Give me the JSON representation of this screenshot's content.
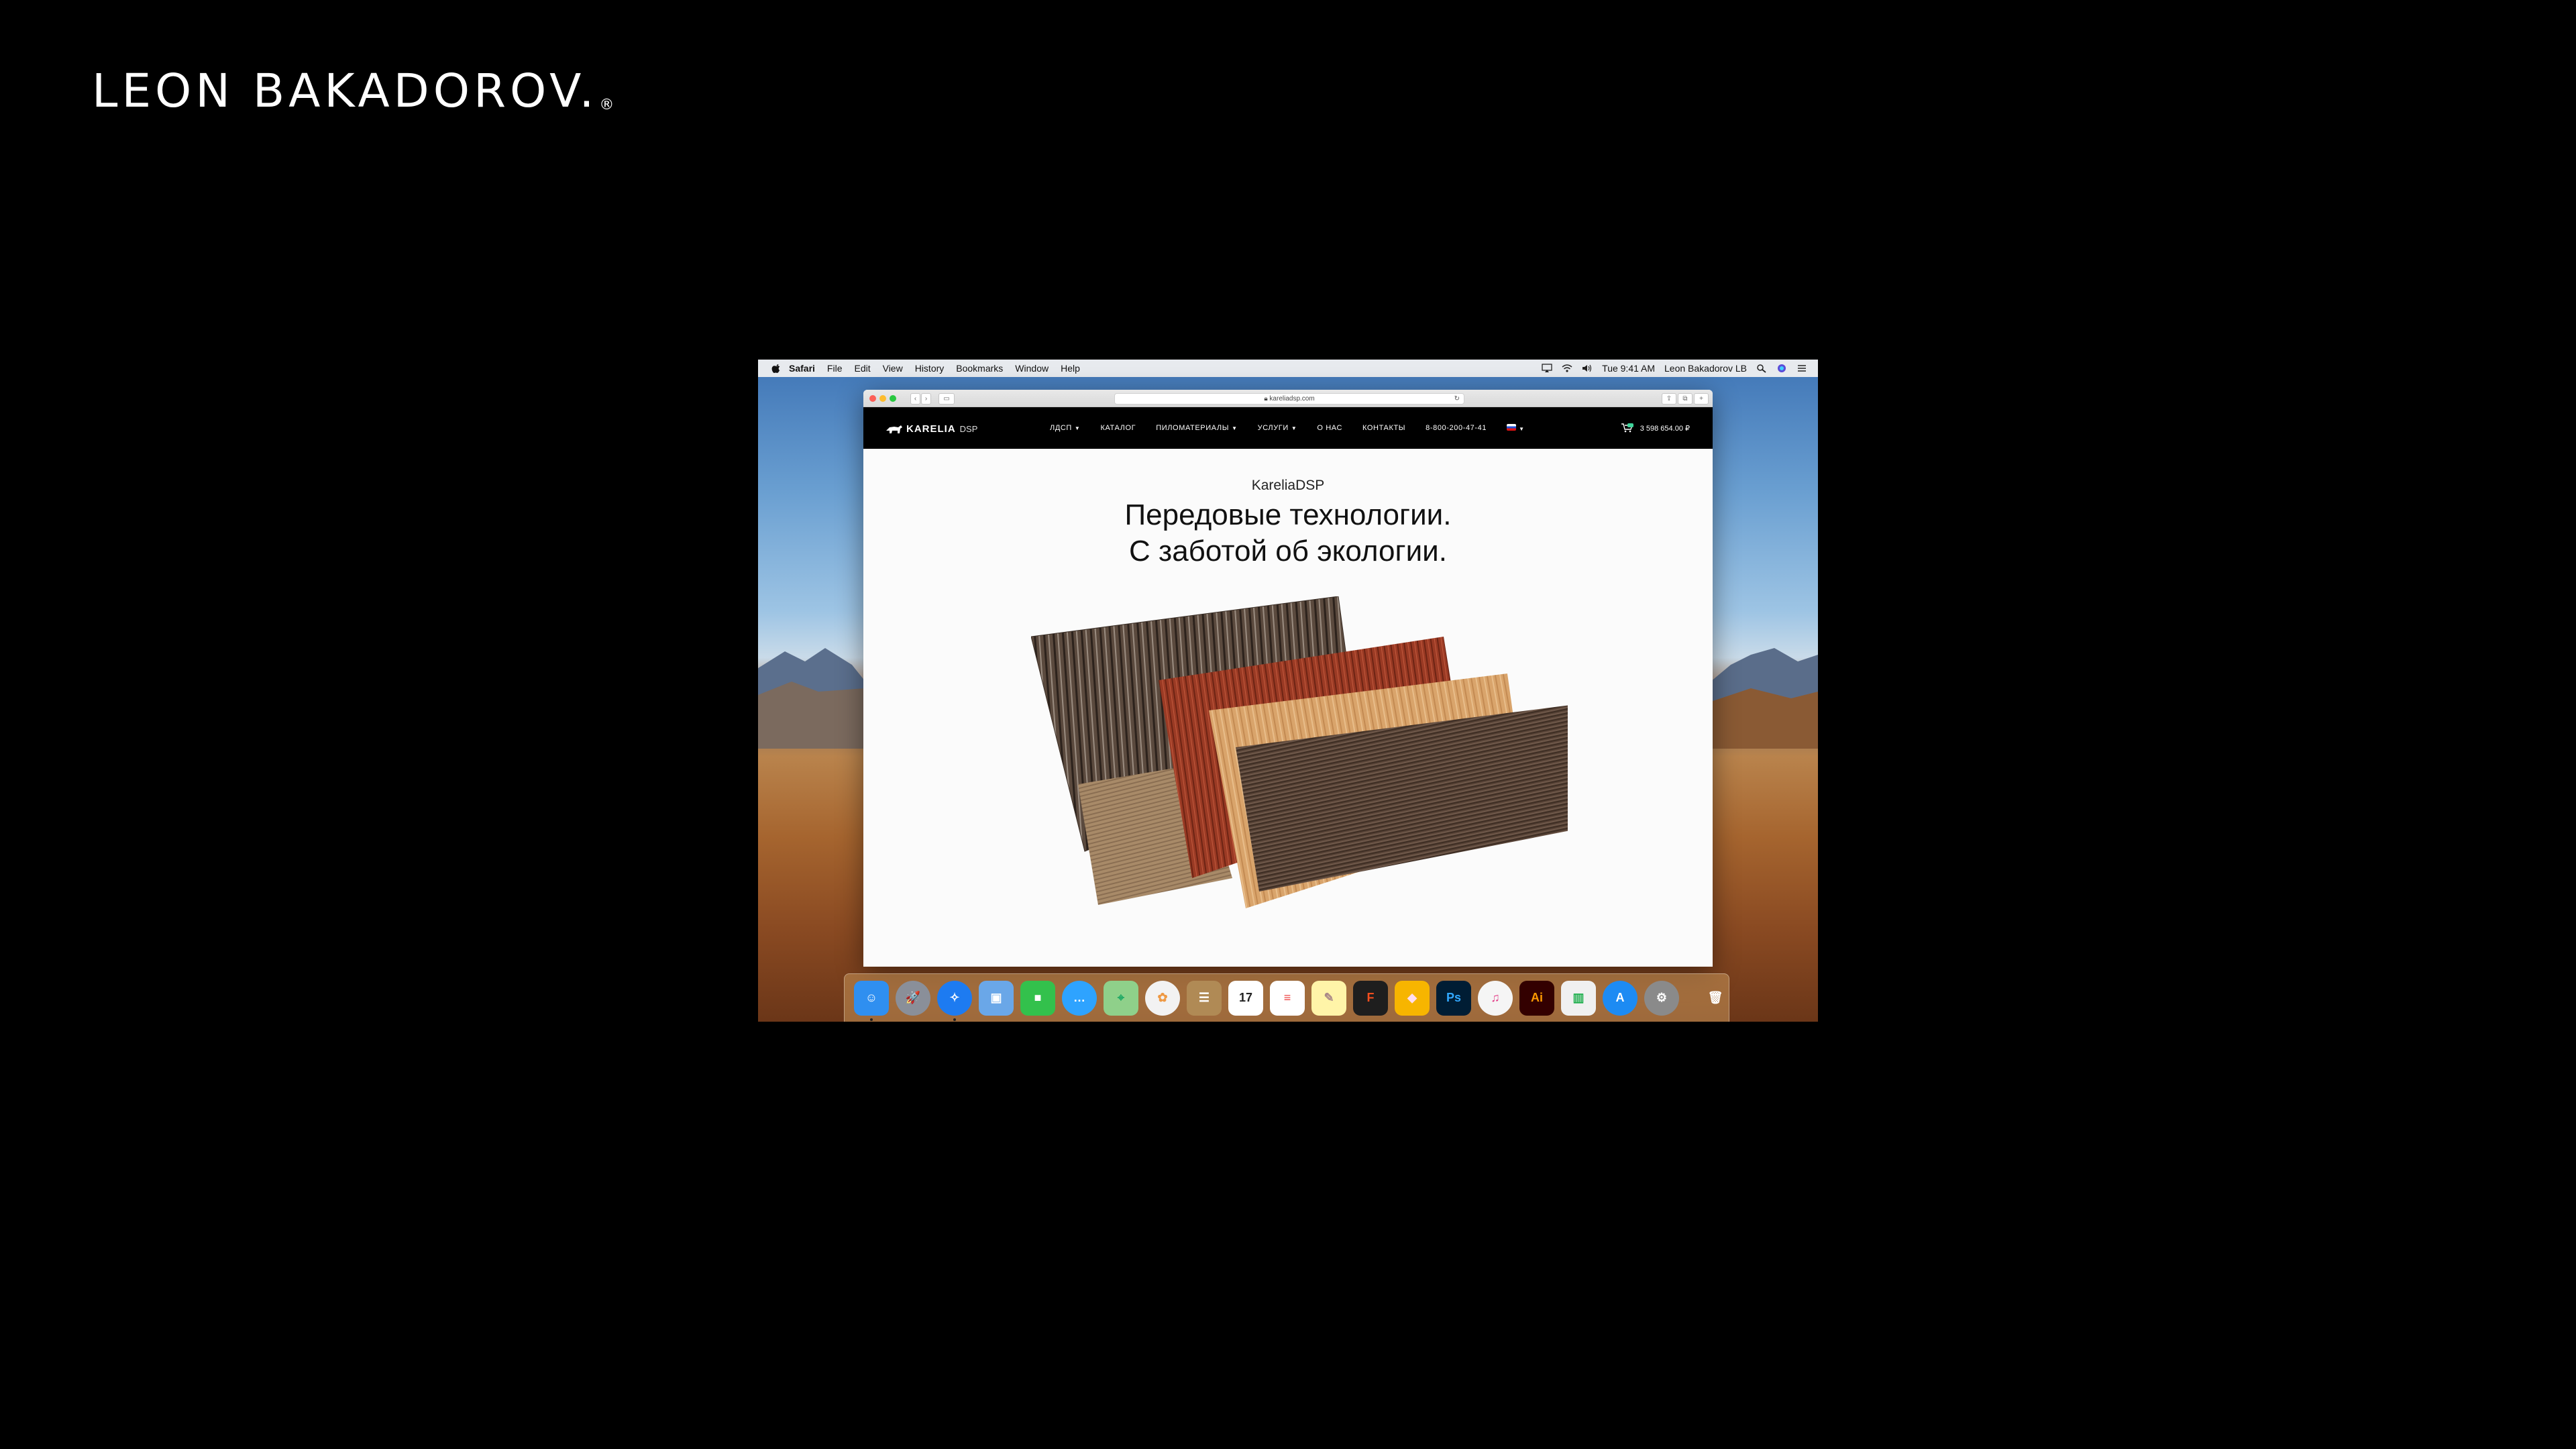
{
  "brand": {
    "name": "LEON BAKADOROV.",
    "registered": "®"
  },
  "menubar": {
    "items": [
      "Safari",
      "File",
      "Edit",
      "View",
      "History",
      "Bookmarks",
      "Window",
      "Help"
    ],
    "clock": "Tue 9:41 AM",
    "user": "Leon Bakadorov LB"
  },
  "browser": {
    "url": "kareliadsp.com",
    "reload": "↻"
  },
  "site": {
    "logo_bold": "KARELIA",
    "logo_thin": "DSP",
    "nav": [
      {
        "label": "ЛДСП",
        "dropdown": true
      },
      {
        "label": "КАТАЛОГ",
        "dropdown": false
      },
      {
        "label": "ПИЛОМАТЕРИАЛЫ",
        "dropdown": true
      },
      {
        "label": "УСЛУГИ",
        "dropdown": true
      },
      {
        "label": "О НАС",
        "dropdown": false
      },
      {
        "label": "КОНТАКТЫ",
        "dropdown": false
      },
      {
        "label": "8-800-200-47-41",
        "dropdown": false
      }
    ],
    "cart_total": "3 598 654.00 ₽",
    "hero": {
      "kicker": "KareliaDSP",
      "headline_line1": "Передовые технологии.",
      "headline_line2": "С заботой об экологии."
    }
  },
  "dock": {
    "apps": [
      {
        "name": "finder",
        "color": "#2f8ff0",
        "glyph": "☺"
      },
      {
        "name": "launchpad",
        "color": "#8a8f99",
        "glyph": "🚀"
      },
      {
        "name": "safari",
        "color": "#1d7bf1",
        "glyph": "✧"
      },
      {
        "name": "preview",
        "color": "#6aa7e8",
        "glyph": "▣"
      },
      {
        "name": "facetime",
        "color": "#33c14c",
        "glyph": "■"
      },
      {
        "name": "messages",
        "color": "#2ea3ff",
        "glyph": "…"
      },
      {
        "name": "maps",
        "color": "#8fd08a",
        "glyph": "⌖"
      },
      {
        "name": "photos",
        "color": "#f2f2f2",
        "glyph": "✿"
      },
      {
        "name": "contacts",
        "color": "#b08a55",
        "glyph": "☰"
      },
      {
        "name": "calendar",
        "color": "#ffffff",
        "glyph": "17"
      },
      {
        "name": "reminders",
        "color": "#ffffff",
        "glyph": "≡"
      },
      {
        "name": "notes",
        "color": "#fff4a8",
        "glyph": "✎"
      },
      {
        "name": "figma",
        "color": "#1e1e1e",
        "glyph": "F"
      },
      {
        "name": "sketch",
        "color": "#f7b500",
        "glyph": "◆"
      },
      {
        "name": "photoshop",
        "color": "#001d34",
        "glyph": "Ps"
      },
      {
        "name": "itunes",
        "color": "#f5f5f5",
        "glyph": "♫"
      },
      {
        "name": "illustrator",
        "color": "#330000",
        "glyph": "Ai"
      },
      {
        "name": "numbers",
        "color": "#f0f0f0",
        "glyph": "▥"
      },
      {
        "name": "app-store",
        "color": "#1d8bf3",
        "glyph": "A"
      },
      {
        "name": "system-preferences",
        "color": "#8a8a8a",
        "glyph": "⚙"
      },
      {
        "name": "trash",
        "color": "#d8d8d8",
        "glyph": "🗑"
      }
    ]
  }
}
